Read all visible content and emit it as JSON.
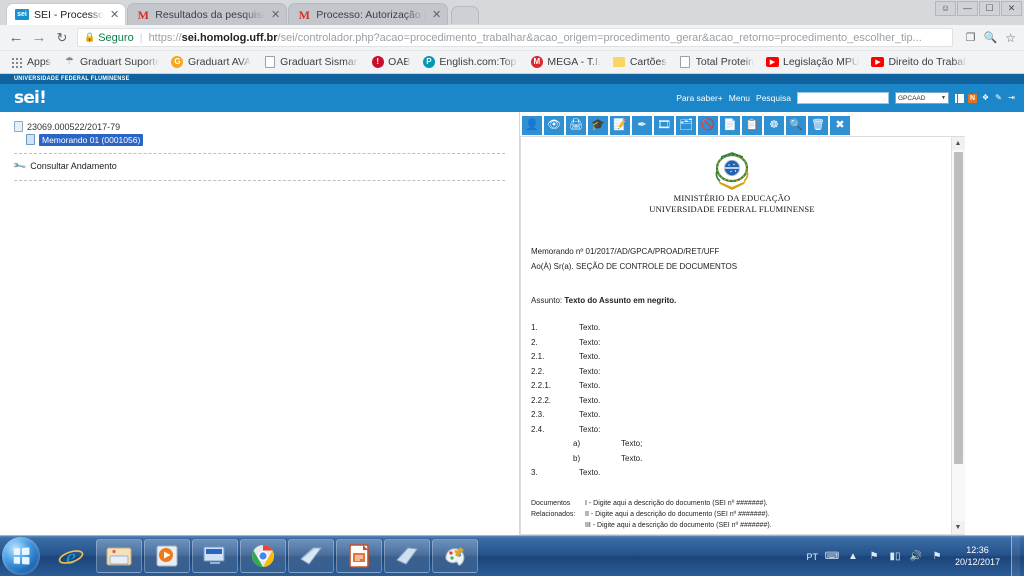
{
  "browser": {
    "tabs": [
      {
        "title": "SEI - Processo",
        "favicon": "sei-icon",
        "active": true
      },
      {
        "title": "Resultados da pesquisa",
        "favicon": "gmail-icon",
        "active": false
      },
      {
        "title": "Processo: Autorização pa",
        "favicon": "gmail-icon",
        "active": false
      }
    ],
    "window_controls": {
      "user": "user-icon",
      "minimize": "minimize-icon",
      "maximize": "maximize-icon",
      "close": "close-icon"
    },
    "nav": {
      "back": "back-arrow-icon",
      "forward": "forward-arrow-icon",
      "reload": "reload-icon"
    },
    "omnibox": {
      "lock": "lock-icon",
      "secure_label": "Seguro",
      "url_scheme": "https://",
      "url_host": "sei.homolog.uff.br",
      "url_path": "/sei/controlador.php?acao=procedimento_trabalhar&acao_origem=procedimento_gerar&acao_retorno=procedimento_escolher_tip...",
      "page_action": "save-page-icon",
      "zoom_icon": "zoom-icon",
      "star_icon": "bookmark-star-icon",
      "menu_icon": "chrome-menu-icon"
    },
    "bookmarks": [
      {
        "label": "Apps",
        "icon": "apps-grid-icon"
      },
      {
        "label": "Graduart Suporte Po",
        "icon": "suporte-icon"
      },
      {
        "label": "Graduart AVA",
        "icon": "ava-icon"
      },
      {
        "label": "Graduart Sismart",
        "icon": "page-icon"
      },
      {
        "label": "OAB",
        "icon": "oab-icon"
      },
      {
        "label": "English.com:Top Note",
        "icon": "pearson-icon"
      },
      {
        "label": "MEGA - T.I.",
        "icon": "mega-icon"
      },
      {
        "label": "Cartões",
        "icon": "folder-icon"
      },
      {
        "label": "Total Protein",
        "icon": "page-icon"
      },
      {
        "label": "Legislação MPU",
        "icon": "youtube-icon"
      },
      {
        "label": "Direito do Trabalho",
        "icon": "youtube-icon"
      }
    ]
  },
  "sei": {
    "org_banner": "UNIVERSIDADE FEDERAL FLUMINENSE",
    "logo": "sei!",
    "header_links": {
      "saber_mais": "Para saber+",
      "menu": "Menu",
      "pesquisa": "Pesquisa"
    },
    "search_value": "",
    "search_placeholder": "",
    "unit_selected": "GPCAAD",
    "header_icons": [
      "menu-grid-icon",
      "alert-icon",
      "user-profile-icon",
      "edit-pencil-icon",
      "logout-icon"
    ],
    "tree": {
      "process_number": "23069.000522/2017-79",
      "document_label": "Memorando 01 (0001056)",
      "action": "Consultar Andamento",
      "action_icon": "wrench-icon"
    },
    "toolbar_buttons": [
      "consultar-processo-icon",
      "visualizar-icon",
      "imprimir-icon",
      "publicar-icon",
      "assinar-documento-icon",
      "caneta-assinatura-icon",
      "gerenciar-marcadores-icon",
      "mover-documento-icon",
      "cancelar-documento-icon",
      "incluir-documento-icon",
      "duplicar-documento-icon",
      "ciencia-icon",
      "pesquisar-icon",
      "excluir-icon",
      "fechar-icon"
    ],
    "scrollbar": {
      "up": "scroll-up-arrow",
      "down": "scroll-down-arrow"
    }
  },
  "document": {
    "brasao": "brasao-republica-icon",
    "ministry": "MINISTÉRIO DA EDUCAÇÃO",
    "university": "UNIVERSIDADE FEDERAL FLUMINENSE",
    "memo_number": "Memorando nº 01/2017/AD/GPCA/PROAD/RET/UFF",
    "recipient": "Ao(À) Sr(a). SEÇÃO DE CONTROLE DE DOCUMENTOS",
    "subject_label": "Assunto: ",
    "subject_value": "Texto do Assunto em negrito.",
    "items": [
      {
        "num": "1.",
        "text": "Texto.",
        "sub": false
      },
      {
        "num": "2.",
        "text": "Texto:",
        "sub": false
      },
      {
        "num": "2.1.",
        "text": "Texto.",
        "sub": false
      },
      {
        "num": "2.2.",
        "text": "Texto:",
        "sub": false
      },
      {
        "num": "2.2.1.",
        "text": "Texto.",
        "sub": false
      },
      {
        "num": "2.2.2.",
        "text": "Texto.",
        "sub": false
      },
      {
        "num": "2.3.",
        "text": "Texto.",
        "sub": false
      },
      {
        "num": "2.4.",
        "text": "Texto:",
        "sub": false
      },
      {
        "num": "a)",
        "text": "Texto;",
        "sub": true
      },
      {
        "num": "b)",
        "text": "Texto.",
        "sub": true
      },
      {
        "num": "3.",
        "text": "Texto.",
        "sub": false
      }
    ],
    "related_label_line1": "Documentos",
    "related_label_line2": "Relacionados:",
    "related": [
      "I - Digite aqui a descrição do documento (SEI nº #######).",
      "II - Digite aqui a descrição do documento (SEI nº #######).",
      "III - Digite aqui a descrição do documento (SEI nº #######)."
    ]
  },
  "taskbar": {
    "start": "windows-start-orb",
    "items": [
      {
        "name": "internet-explorer-icon",
        "pinned": true
      },
      {
        "name": "file-explorer-icon",
        "pinned": true
      },
      {
        "name": "media-player-icon",
        "pinned": true
      },
      {
        "name": "remote-desktop-icon",
        "pinned": true
      },
      {
        "name": "google-chrome-icon",
        "pinned": false
      },
      {
        "name": "notepad-window-icon",
        "pinned": false
      },
      {
        "name": "libreoffice-icon",
        "pinned": false
      },
      {
        "name": "window-icon",
        "pinned": false
      },
      {
        "name": "paint-icon",
        "pinned": false
      }
    ],
    "tray": {
      "language": "PT",
      "keyboard_icon": "keyboard-icon",
      "show_hidden_icon": "show-hidden-icons-arrow",
      "action_center_icon": "action-center-icon",
      "network_icon": "network-signal-icon",
      "volume_icon": "volume-icon",
      "security_icon": "security-alert-icon",
      "time": "12:36",
      "date": "20/12/2017"
    }
  }
}
